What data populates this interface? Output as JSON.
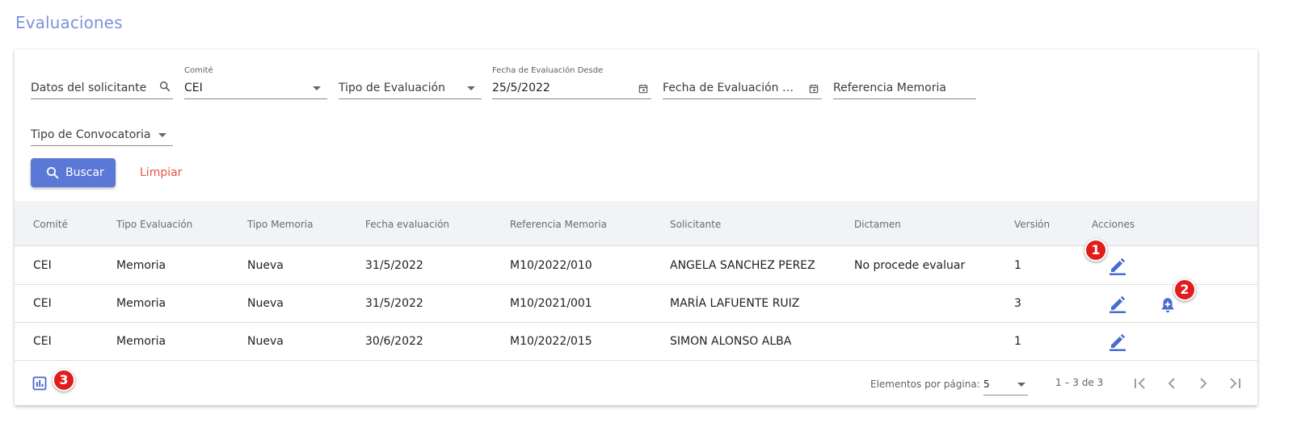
{
  "page": {
    "title": "Evaluaciones"
  },
  "filters": {
    "datos_solicitante": {
      "placeholder": "Datos del solicitante"
    },
    "comite": {
      "label": "Comité",
      "value": "CEI"
    },
    "tipo_evaluacion": {
      "placeholder": "Tipo de Evaluación"
    },
    "fecha_desde": {
      "label": "Fecha de Evaluación Desde",
      "value": "25/5/2022"
    },
    "fecha_hasta": {
      "placeholder": "Fecha de Evaluación Ha..."
    },
    "referencia_memoria": {
      "placeholder": "Referencia Memoria"
    },
    "tipo_convocatoria": {
      "placeholder": "Tipo de Convocatoria"
    }
  },
  "actions": {
    "buscar": "Buscar",
    "limpiar": "Limpiar"
  },
  "table": {
    "headers": [
      "Comité",
      "Tipo Evaluación",
      "Tipo Memoria",
      "Fecha evaluación",
      "Referencia Memoria",
      "Solicitante",
      "Dictamen",
      "Versión",
      "Acciones"
    ],
    "rows": [
      {
        "comite": "CEI",
        "tipo_evaluacion": "Memoria",
        "tipo_memoria": "Nueva",
        "fecha": "31/5/2022",
        "referencia": "M10/2022/010",
        "solicitante": "ANGELA SANCHEZ PEREZ",
        "dictamen": "No procede evaluar",
        "version": "1",
        "actions": [
          "edit-icon"
        ]
      },
      {
        "comite": "CEI",
        "tipo_evaluacion": "Memoria",
        "tipo_memoria": "Nueva",
        "fecha": "31/5/2022",
        "referencia": "M10/2021/001",
        "solicitante": "MARÍA LAFUENTE RUIZ",
        "dictamen": "",
        "version": "3",
        "actions": [
          "edit-icon",
          "add-alert-icon"
        ]
      },
      {
        "comite": "CEI",
        "tipo_evaluacion": "Memoria",
        "tipo_memoria": "Nueva",
        "fecha": "30/6/2022",
        "referencia": "M10/2022/015",
        "solicitante": "SIMON ALONSO ALBA",
        "dictamen": "",
        "version": "1",
        "actions": [
          "edit-icon"
        ]
      }
    ]
  },
  "pagination": {
    "label": "Elementos por página:",
    "page_size": "5",
    "range": "1 – 3 de 3"
  },
  "annotations": {
    "badge_1": "1",
    "badge_2": "2",
    "badge_3": "3"
  },
  "icons": {
    "search": "search-icon",
    "calendar": "calendar-icon",
    "edit": "edit-icon",
    "bell": "add-alert-icon",
    "chart": "bar-chart-icon"
  },
  "colors": {
    "primary": "#5a78d6",
    "title": "#7b93dc",
    "danger": "#e0564a",
    "badge": "#e21b1b",
    "icon": "#4a6bcf"
  }
}
